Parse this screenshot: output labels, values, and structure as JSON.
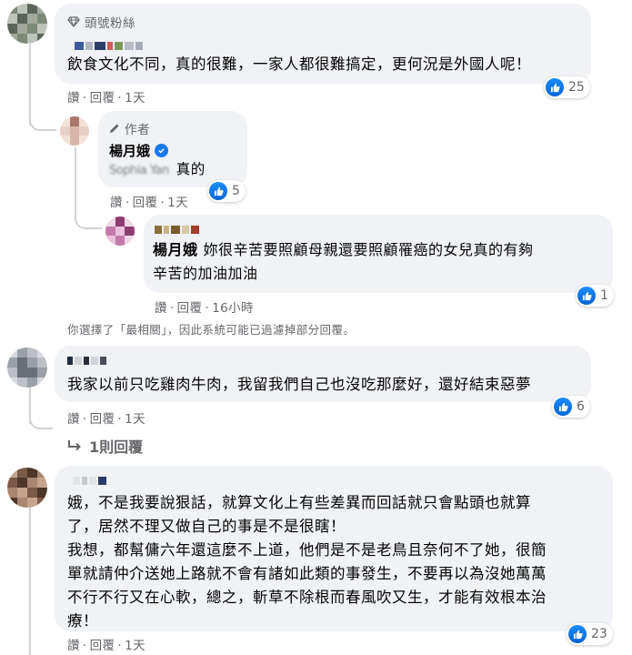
{
  "actions": {
    "like": "讚",
    "reply": "回覆",
    "sep": "·"
  },
  "comments": [
    {
      "badge": "頭號粉絲",
      "text_lines": [
        "飲食文化不同，真的很難，一家人都很難搞定，更何況是外國人呢！"
      ],
      "time": "1天",
      "likes": "25",
      "colors": {
        "avatar": [
          "#7d8a77",
          "#bfc4bb",
          "#5c6656",
          "#a2a99b"
        ]
      }
    },
    {
      "author_label": "作者",
      "author_name": "楊月娥",
      "mention": "Sophia Yan",
      "text": "真的",
      "time": "1天",
      "likes": "5",
      "colors": {
        "avatar": [
          "#d9b7a8",
          "#f3e2da",
          "#a8786b",
          "#e9cfc4"
        ]
      }
    },
    {
      "mention_name": "楊月娥",
      "text_lines": [
        "妳很辛苦要照顧母親還要照顧罹癌的女兒真的有夠",
        "辛苦的加油加油"
      ],
      "time": "16小時",
      "likes": "1",
      "colors": {
        "avatar": [
          "#c37aa8",
          "#e9c3dc",
          "#8d3c70",
          "#f2d9e8"
        ]
      }
    },
    {
      "text_lines": [
        "我家以前只吃雞肉牛肉，我留我們自己也沒吃那麼好，還好結束惡夢"
      ],
      "time": "1天",
      "likes": "6",
      "reply_link": "1則回覆",
      "colors": {
        "avatar": [
          "#9aa0a6",
          "#d6d9dc",
          "#6b7075",
          "#bcc0c4"
        ]
      }
    },
    {
      "text_lines": [
        "娥，不是我要說狠話，就算文化上有些差異而回話就只會點頭也就算",
        "了，居然不理又做自己的事是不是很瞎！",
        "我想，都幫傭六年還這麼不上道，他們是不是老鳥且奈何不了她，很簡",
        "單就請仲介送她上路就不會有諸如此類的事發生，不要再以為沒她萬萬",
        "不行不行又在心軟，總之，斬草不除根而春風吹又生，才能有效根本治",
        "療！"
      ],
      "time": "1天",
      "likes": "23",
      "colors": {
        "avatar": [
          "#7a5b48",
          "#c4a48c",
          "#4e3628",
          "#a98670"
        ]
      }
    }
  ],
  "filter_notice": "你選擇了「最相關」，因此系統可能已過濾掉部分回覆。",
  "colors": {
    "bubble": "#f0f2f5",
    "secondary_text": "#65676b",
    "like_blue": "#1877f2"
  }
}
